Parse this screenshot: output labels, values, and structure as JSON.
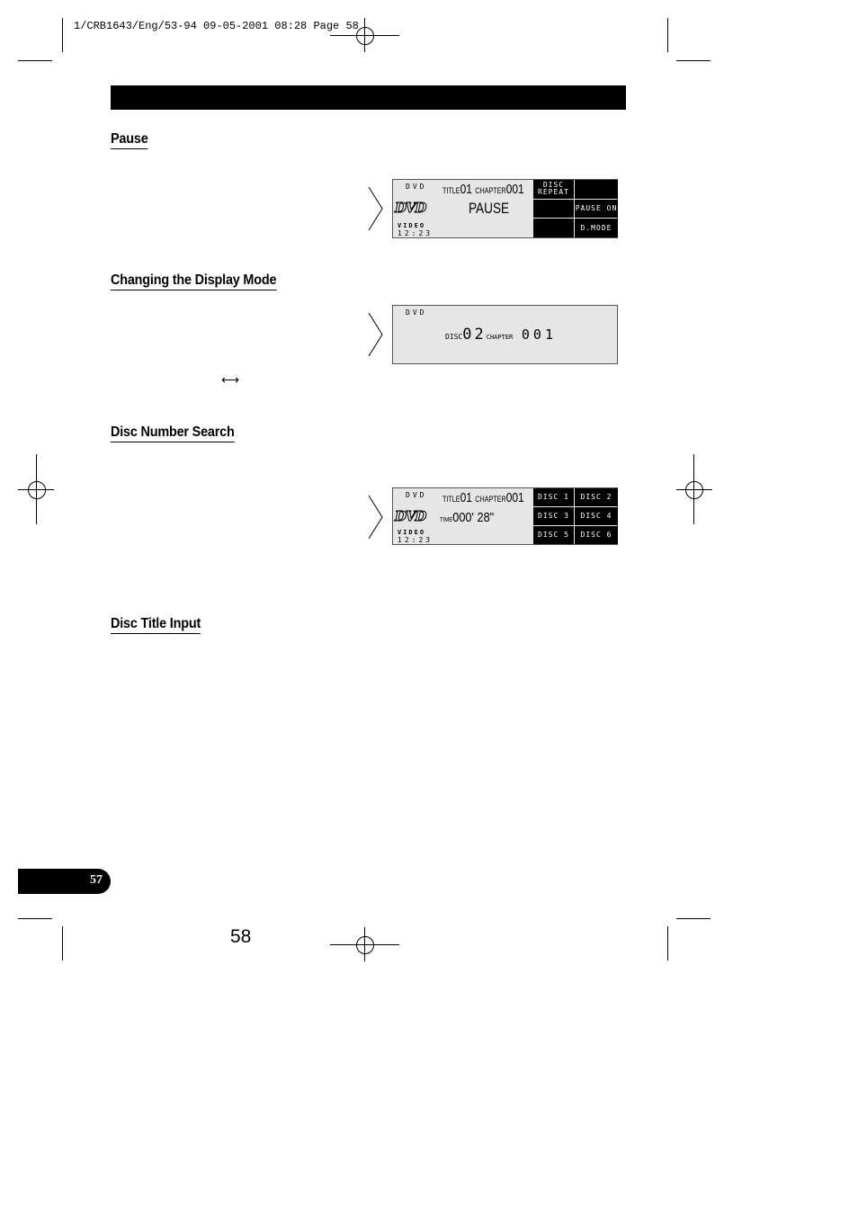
{
  "header": "1/CRB1643/Eng/53-94   09-05-2001 08:28  Page 58",
  "sections": [
    "Pause",
    "Changing the Display Mode",
    "Disc Number Search",
    "Disc Title Input"
  ],
  "display1": {
    "dvd": "DVD",
    "logo": "DVD",
    "video": "VIDEO",
    "clock": "12:23",
    "title_label": "TITLE",
    "title": "01",
    "chapter_label": "CHAPTER",
    "chapter": "001",
    "main": "PAUSE",
    "buttons": [
      "DISC REPEAT",
      "",
      "",
      "PAUSE ON",
      "",
      "D.MODE"
    ]
  },
  "display2": {
    "dvd": "DVD",
    "disc_label": "DISC",
    "disc": "02",
    "chapter_label": "CHAPTER",
    "chapter": "001"
  },
  "display3": {
    "dvd": "DVD",
    "logo": "DVD",
    "video": "VIDEO",
    "clock": "12:23",
    "title_label": "TITLE",
    "title": "01",
    "chapter_label": "CHAPTER",
    "chapter": "001",
    "time_label": "TIME",
    "time": "000' 28\"",
    "buttons": [
      "DISC 1",
      "DISC 2",
      "DISC 3",
      "DISC 4",
      "DISC 5",
      "DISC 6"
    ]
  },
  "arrow_symbol": "⟷",
  "page_tab": "57",
  "page_number": "58"
}
